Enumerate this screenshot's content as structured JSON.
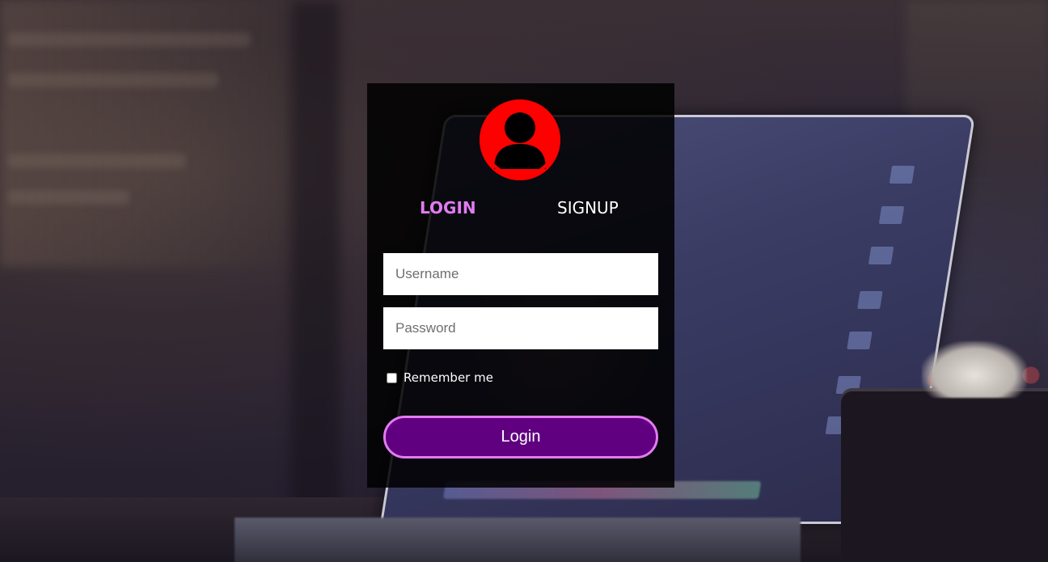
{
  "tabs": {
    "login_label": "LOGIN",
    "signup_label": "SIGNUP"
  },
  "form": {
    "username_placeholder": "Username",
    "password_placeholder": "Password",
    "remember_label": "Remember me",
    "remember_checked": false,
    "submit_label": "Login"
  },
  "icons": {
    "avatar": "user-avatar-icon"
  },
  "colors": {
    "avatar": "#ff0000",
    "active_tab": "#e27cf0",
    "button_fill": "#600080",
    "button_border": "#e27cf0",
    "panel": "#000000"
  }
}
